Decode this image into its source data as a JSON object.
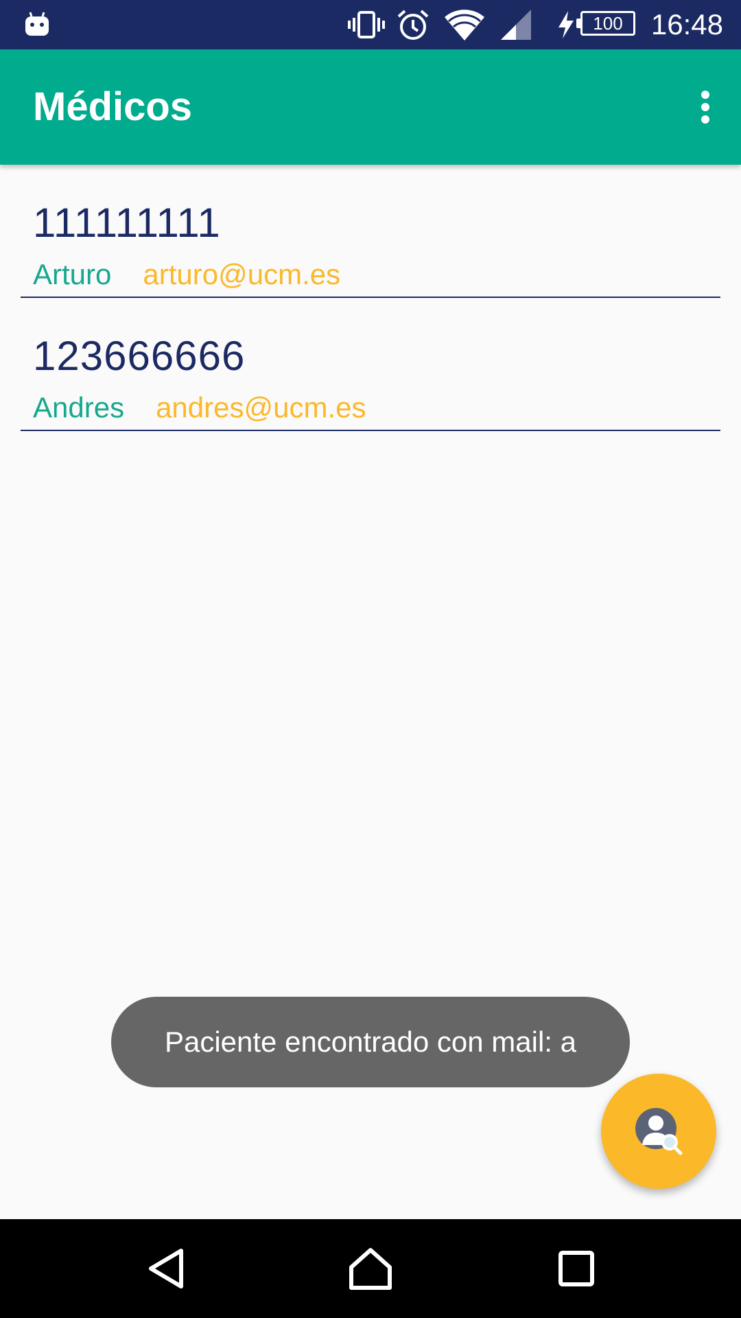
{
  "status_bar": {
    "time": "16:48",
    "battery_level": "100",
    "icons": [
      "android-notification-icon",
      "vibrate-icon",
      "alarm-icon",
      "wifi-icon",
      "signal-icon",
      "charging-icon",
      "battery-icon"
    ]
  },
  "app_bar": {
    "title": "Médicos",
    "menu_icon": "overflow-menu-icon"
  },
  "list": {
    "items": [
      {
        "id": "111111111",
        "name": "Arturo",
        "email": "arturo@ucm.es"
      },
      {
        "id": "123666666",
        "name": "Andres",
        "email": "andres@ucm.es"
      }
    ]
  },
  "toast": {
    "message": "Paciente encontrado con mail: a"
  },
  "fab": {
    "icon": "search-person-icon"
  },
  "nav_bar": {
    "icons": [
      "back-icon",
      "home-icon",
      "recents-icon"
    ]
  },
  "colors": {
    "status_bar": "#1c2a63",
    "app_bar": "#00ab8e",
    "id_text": "#1c2a63",
    "name_text": "#16a88e",
    "email_text": "#fbb829",
    "fab": "#fbb829",
    "toast": "#666666",
    "nav_bar": "#000000"
  }
}
